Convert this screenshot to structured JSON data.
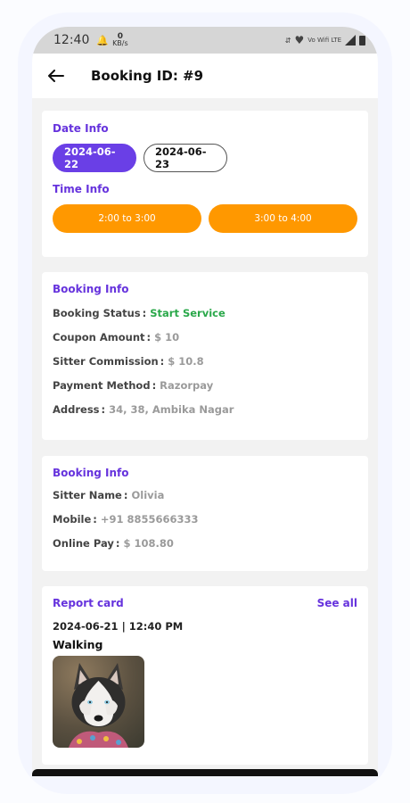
{
  "status_bar": {
    "time": "12:40",
    "speed_value": "0",
    "speed_unit": "KB/s",
    "network": "Vo Wifi LTE"
  },
  "app_bar": {
    "back_icon": "arrow-left-icon",
    "title": "Booking ID: #9"
  },
  "date_info": {
    "title": "Date Info",
    "dates": [
      {
        "label": "2024-06-22",
        "selected": true
      },
      {
        "label": "2024-06-23",
        "selected": false
      }
    ]
  },
  "time_info": {
    "title": "Time Info",
    "slots": [
      "2:00 to 3:00",
      "3:00 to 4:00"
    ]
  },
  "booking_info": {
    "title": "Booking Info",
    "rows": [
      {
        "label": "Booking Status",
        "value": "Start Service"
      },
      {
        "label": "Coupon Amount",
        "value": "$ 10"
      },
      {
        "label": "Sitter Commission",
        "value": "$ 10.8"
      },
      {
        "label": "Payment Method",
        "value": "Razorpay"
      },
      {
        "label": "Address",
        "value": "34, 38, Ambika Nagar"
      }
    ]
  },
  "sitter_info": {
    "title": "Booking Info",
    "rows": [
      {
        "label": "Sitter Name",
        "value": "Olivia"
      },
      {
        "label": "Mobile",
        "value": "+91 8855666333"
      },
      {
        "label": "Online Pay",
        "value": "$ 108.80"
      }
    ]
  },
  "report_card": {
    "title": "Report card",
    "see_all": "See all",
    "datetime": "2024-06-21 | 12:40 PM",
    "activity": "Walking",
    "photo": "husky-dog-photo"
  },
  "colors": {
    "accent": "#6a3fe6",
    "slot": "#ff9800",
    "status_green": "#2aa84a"
  }
}
